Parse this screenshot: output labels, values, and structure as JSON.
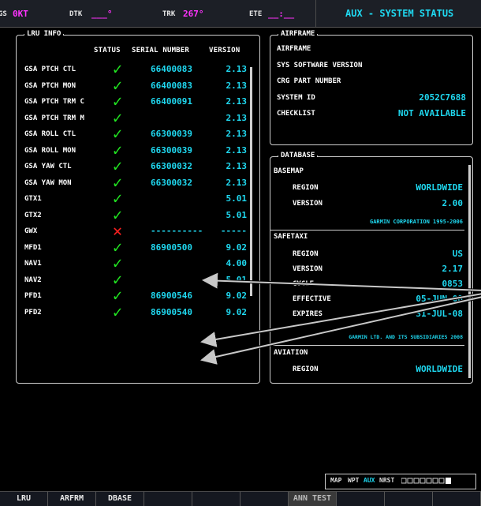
{
  "topbar": {
    "gs_label": "GS",
    "gs_value": "0KT",
    "dtk_label": "DTK",
    "dtk_value": "___°",
    "trk_label": "TRK",
    "trk_value": "267°",
    "ete_label": "ETE",
    "ete_value": "__:__",
    "page_title": "AUX - SYSTEM STATUS"
  },
  "lru": {
    "title": "LRU INFO",
    "headers": {
      "status": "STATUS",
      "serial": "SERIAL NUMBER",
      "version": "VERSION"
    },
    "rows": [
      {
        "name": "GSA PTCH CTL",
        "ok": true,
        "serial": "66400083",
        "version": "2.13"
      },
      {
        "name": "GSA PTCH MON",
        "ok": true,
        "serial": "66400083",
        "version": "2.13"
      },
      {
        "name": "GSA PTCH TRM C",
        "ok": true,
        "serial": "66400091",
        "version": "2.13"
      },
      {
        "name": "GSA PTCH TRM M",
        "ok": true,
        "serial": "",
        "version": "2.13"
      },
      {
        "name": "GSA ROLL CTL",
        "ok": true,
        "serial": "66300039",
        "version": "2.13"
      },
      {
        "name": "GSA ROLL MON",
        "ok": true,
        "serial": "66300039",
        "version": "2.13"
      },
      {
        "name": "GSA YAW CTL",
        "ok": true,
        "serial": "66300032",
        "version": "2.13"
      },
      {
        "name": "GSA YAW MON",
        "ok": true,
        "serial": "66300032",
        "version": "2.13"
      },
      {
        "name": "GTX1",
        "ok": true,
        "serial": "",
        "version": "5.01"
      },
      {
        "name": "GTX2",
        "ok": true,
        "serial": "",
        "version": "5.01"
      },
      {
        "name": "GWX",
        "ok": false,
        "serial": "----------",
        "version": "-----"
      },
      {
        "name": "MFD1",
        "ok": true,
        "serial": "86900500",
        "version": "9.02"
      },
      {
        "name": "NAV1",
        "ok": true,
        "serial": "",
        "version": "4.00"
      },
      {
        "name": "NAV2",
        "ok": true,
        "serial": "",
        "version": "5.01"
      },
      {
        "name": "PFD1",
        "ok": true,
        "serial": "86900546",
        "version": "9.02"
      },
      {
        "name": "PFD2",
        "ok": true,
        "serial": "86900540",
        "version": "9.02"
      }
    ],
    "ok_glyph": "✓",
    "fail_glyph": "✕"
  },
  "airframe": {
    "title": "AIRFRAME",
    "rows": [
      {
        "k": "AIRFRAME",
        "v": ""
      },
      {
        "k": "SYS SOFTWARE VERSION",
        "v": ""
      },
      {
        "k": "CRG PART NUMBER",
        "v": ""
      },
      {
        "k": "SYSTEM ID",
        "v": "2052C7688"
      },
      {
        "k": "CHECKLIST",
        "v": "NOT AVAILABLE"
      }
    ]
  },
  "database": {
    "title": "DATABASE",
    "basemap": {
      "label": "BASEMAP",
      "region_k": "REGION",
      "region_v": "WORLDWIDE",
      "version_k": "VERSION",
      "version_v": "2.00",
      "copyright": "GARMIN CORPORATION 1995-2006"
    },
    "safetaxi": {
      "label": "SAFETAXI",
      "region_k": "REGION",
      "region_v": "US",
      "version_k": "VERSION",
      "version_v": "2.17",
      "cycle_k": "CYCLE",
      "cycle_v": "0853",
      "effective_k": "EFFECTIVE",
      "effective_v": "05-JUN-08",
      "expires_k": "EXPIRES",
      "expires_v": "31-JUL-08",
      "copyright": "GARMIN LTD. AND ITS SUBSIDIARIES 2008"
    },
    "aviation": {
      "label": "AVIATION",
      "region_k": "REGION",
      "region_v": "WORLDWIDE"
    }
  },
  "mapbar": {
    "map": "MAP",
    "wpt": "WPT",
    "aux": "AUX",
    "nrst": "NRST"
  },
  "softkeys": [
    "LRU",
    "ARFRM",
    "DBASE",
    "",
    "",
    "",
    "ANN TEST",
    "",
    "",
    ""
  ],
  "colors": {
    "cyan": "#1fd8f0",
    "magenta": "#ff33ff",
    "ok": "#22e822",
    "fail": "#ff2020"
  }
}
